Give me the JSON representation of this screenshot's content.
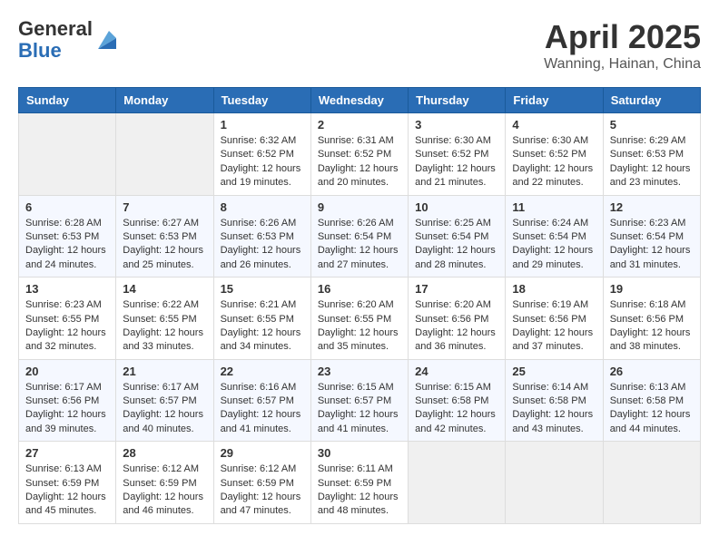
{
  "header": {
    "logo_line1": "General",
    "logo_line2": "Blue",
    "month": "April 2025",
    "location": "Wanning, Hainan, China"
  },
  "weekdays": [
    "Sunday",
    "Monday",
    "Tuesday",
    "Wednesday",
    "Thursday",
    "Friday",
    "Saturday"
  ],
  "weeks": [
    [
      {
        "day": "",
        "sunrise": "",
        "sunset": "",
        "daylight": ""
      },
      {
        "day": "",
        "sunrise": "",
        "sunset": "",
        "daylight": ""
      },
      {
        "day": "1",
        "sunrise": "Sunrise: 6:32 AM",
        "sunset": "Sunset: 6:52 PM",
        "daylight": "Daylight: 12 hours and 19 minutes."
      },
      {
        "day": "2",
        "sunrise": "Sunrise: 6:31 AM",
        "sunset": "Sunset: 6:52 PM",
        "daylight": "Daylight: 12 hours and 20 minutes."
      },
      {
        "day": "3",
        "sunrise": "Sunrise: 6:30 AM",
        "sunset": "Sunset: 6:52 PM",
        "daylight": "Daylight: 12 hours and 21 minutes."
      },
      {
        "day": "4",
        "sunrise": "Sunrise: 6:30 AM",
        "sunset": "Sunset: 6:52 PM",
        "daylight": "Daylight: 12 hours and 22 minutes."
      },
      {
        "day": "5",
        "sunrise": "Sunrise: 6:29 AM",
        "sunset": "Sunset: 6:53 PM",
        "daylight": "Daylight: 12 hours and 23 minutes."
      }
    ],
    [
      {
        "day": "6",
        "sunrise": "Sunrise: 6:28 AM",
        "sunset": "Sunset: 6:53 PM",
        "daylight": "Daylight: 12 hours and 24 minutes."
      },
      {
        "day": "7",
        "sunrise": "Sunrise: 6:27 AM",
        "sunset": "Sunset: 6:53 PM",
        "daylight": "Daylight: 12 hours and 25 minutes."
      },
      {
        "day": "8",
        "sunrise": "Sunrise: 6:26 AM",
        "sunset": "Sunset: 6:53 PM",
        "daylight": "Daylight: 12 hours and 26 minutes."
      },
      {
        "day": "9",
        "sunrise": "Sunrise: 6:26 AM",
        "sunset": "Sunset: 6:54 PM",
        "daylight": "Daylight: 12 hours and 27 minutes."
      },
      {
        "day": "10",
        "sunrise": "Sunrise: 6:25 AM",
        "sunset": "Sunset: 6:54 PM",
        "daylight": "Daylight: 12 hours and 28 minutes."
      },
      {
        "day": "11",
        "sunrise": "Sunrise: 6:24 AM",
        "sunset": "Sunset: 6:54 PM",
        "daylight": "Daylight: 12 hours and 29 minutes."
      },
      {
        "day": "12",
        "sunrise": "Sunrise: 6:23 AM",
        "sunset": "Sunset: 6:54 PM",
        "daylight": "Daylight: 12 hours and 31 minutes."
      }
    ],
    [
      {
        "day": "13",
        "sunrise": "Sunrise: 6:23 AM",
        "sunset": "Sunset: 6:55 PM",
        "daylight": "Daylight: 12 hours and 32 minutes."
      },
      {
        "day": "14",
        "sunrise": "Sunrise: 6:22 AM",
        "sunset": "Sunset: 6:55 PM",
        "daylight": "Daylight: 12 hours and 33 minutes."
      },
      {
        "day": "15",
        "sunrise": "Sunrise: 6:21 AM",
        "sunset": "Sunset: 6:55 PM",
        "daylight": "Daylight: 12 hours and 34 minutes."
      },
      {
        "day": "16",
        "sunrise": "Sunrise: 6:20 AM",
        "sunset": "Sunset: 6:55 PM",
        "daylight": "Daylight: 12 hours and 35 minutes."
      },
      {
        "day": "17",
        "sunrise": "Sunrise: 6:20 AM",
        "sunset": "Sunset: 6:56 PM",
        "daylight": "Daylight: 12 hours and 36 minutes."
      },
      {
        "day": "18",
        "sunrise": "Sunrise: 6:19 AM",
        "sunset": "Sunset: 6:56 PM",
        "daylight": "Daylight: 12 hours and 37 minutes."
      },
      {
        "day": "19",
        "sunrise": "Sunrise: 6:18 AM",
        "sunset": "Sunset: 6:56 PM",
        "daylight": "Daylight: 12 hours and 38 minutes."
      }
    ],
    [
      {
        "day": "20",
        "sunrise": "Sunrise: 6:17 AM",
        "sunset": "Sunset: 6:56 PM",
        "daylight": "Daylight: 12 hours and 39 minutes."
      },
      {
        "day": "21",
        "sunrise": "Sunrise: 6:17 AM",
        "sunset": "Sunset: 6:57 PM",
        "daylight": "Daylight: 12 hours and 40 minutes."
      },
      {
        "day": "22",
        "sunrise": "Sunrise: 6:16 AM",
        "sunset": "Sunset: 6:57 PM",
        "daylight": "Daylight: 12 hours and 41 minutes."
      },
      {
        "day": "23",
        "sunrise": "Sunrise: 6:15 AM",
        "sunset": "Sunset: 6:57 PM",
        "daylight": "Daylight: 12 hours and 41 minutes."
      },
      {
        "day": "24",
        "sunrise": "Sunrise: 6:15 AM",
        "sunset": "Sunset: 6:58 PM",
        "daylight": "Daylight: 12 hours and 42 minutes."
      },
      {
        "day": "25",
        "sunrise": "Sunrise: 6:14 AM",
        "sunset": "Sunset: 6:58 PM",
        "daylight": "Daylight: 12 hours and 43 minutes."
      },
      {
        "day": "26",
        "sunrise": "Sunrise: 6:13 AM",
        "sunset": "Sunset: 6:58 PM",
        "daylight": "Daylight: 12 hours and 44 minutes."
      }
    ],
    [
      {
        "day": "27",
        "sunrise": "Sunrise: 6:13 AM",
        "sunset": "Sunset: 6:59 PM",
        "daylight": "Daylight: 12 hours and 45 minutes."
      },
      {
        "day": "28",
        "sunrise": "Sunrise: 6:12 AM",
        "sunset": "Sunset: 6:59 PM",
        "daylight": "Daylight: 12 hours and 46 minutes."
      },
      {
        "day": "29",
        "sunrise": "Sunrise: 6:12 AM",
        "sunset": "Sunset: 6:59 PM",
        "daylight": "Daylight: 12 hours and 47 minutes."
      },
      {
        "day": "30",
        "sunrise": "Sunrise: 6:11 AM",
        "sunset": "Sunset: 6:59 PM",
        "daylight": "Daylight: 12 hours and 48 minutes."
      },
      {
        "day": "",
        "sunrise": "",
        "sunset": "",
        "daylight": ""
      },
      {
        "day": "",
        "sunrise": "",
        "sunset": "",
        "daylight": ""
      },
      {
        "day": "",
        "sunrise": "",
        "sunset": "",
        "daylight": ""
      }
    ]
  ]
}
